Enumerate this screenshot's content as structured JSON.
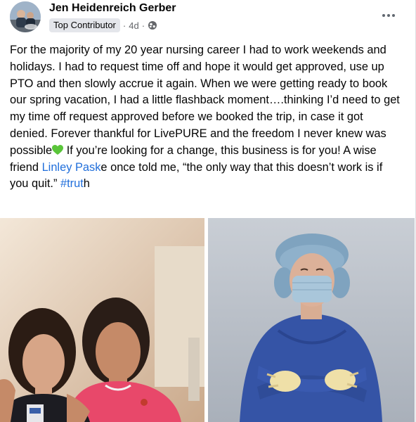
{
  "post": {
    "author": {
      "name": "Jen Heidenreich Gerber",
      "badge": "Top Contributor",
      "time": "4d",
      "separator": "·",
      "audience_icon": "globe-icon"
    },
    "menu_icon": "more-options-icon",
    "text": {
      "part1": "For the majority of my 20 year nursing career I had to work weekends and holidays. I had to request time off and hope it would get approved, use up PTO and then slowly accrue it again. When we were getting ready to book our spring vacation, I had a little flashback moment….thinking I’d need to get my time off request approved before we booked the trip, in case it got denied. Forever thankful for LivePURE and the freedom I never knew was possible",
      "emoji": "green-heart-icon",
      "part2": " If you’re looking for a change, this business is for you! A wise friend ",
      "mention_a": "Linley",
      "mention_space": " ",
      "mention_b": "Pask",
      "part3": "e once told me, “the only way that this doesn’t work is if you quit.”",
      "hashtag_link": "#trut",
      "hashtag_tail": "h"
    },
    "photos": [
      {
        "name": "photo-two-women-smiling"
      },
      {
        "name": "photo-nurse-in-surgical-gown"
      }
    ],
    "colors": {
      "link": "#216fdb",
      "badge_bg": "#e4e6eb",
      "meta_text": "#65676b"
    }
  }
}
